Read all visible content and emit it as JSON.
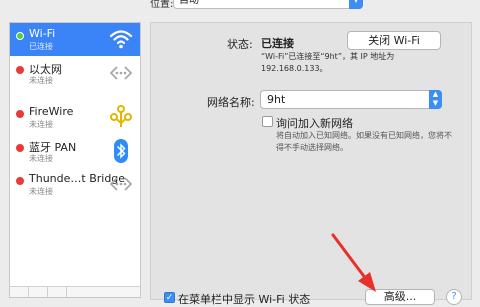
{
  "location": {
    "label": "位置:",
    "value": "自动"
  },
  "networks": [
    {
      "name": "Wi-Fi",
      "status": "已连接",
      "icon": "wifi-icon",
      "dot": "green",
      "selected": true
    },
    {
      "name": "以太网",
      "status": "未连接",
      "icon": "ethernet-icon",
      "dot": "red"
    },
    {
      "name": "FireWire",
      "status": "未连接",
      "icon": "firewire-icon",
      "dot": "red"
    },
    {
      "name": "蓝牙 PAN",
      "status": "未连接",
      "icon": "bluetooth-icon",
      "dot": "red"
    },
    {
      "name": "Thunde…t Bridge",
      "status": "未连接",
      "icon": "thunderbolt-bridge-icon",
      "dot": "red"
    }
  ],
  "main": {
    "status_label": "状态:",
    "status_value": "已连接",
    "turn_off_button": "关闭 Wi-Fi",
    "status_detail_line1": "“Wi-Fi”已连接至“9ht”，其 IP 地址为",
    "status_detail_line2": "192.168.0.133。",
    "network_name_label": "网络名称:",
    "network_name_value": "9ht",
    "ask_join_label": "询问加入新网络",
    "ask_join_desc_line1": "将自动加入已知网络。如果没有已知网络，您将不",
    "ask_join_desc_line2": "得不手动选择网络。",
    "show_menubar_label": "在菜单栏中显示 Wi-Fi 状态",
    "advanced_button": "高级...",
    "help_button": "?"
  },
  "colors": {
    "accent": "#3a84f7",
    "connected": "#4cd23f",
    "disconnected": "#e8393b",
    "arrow": "#e8302a"
  }
}
